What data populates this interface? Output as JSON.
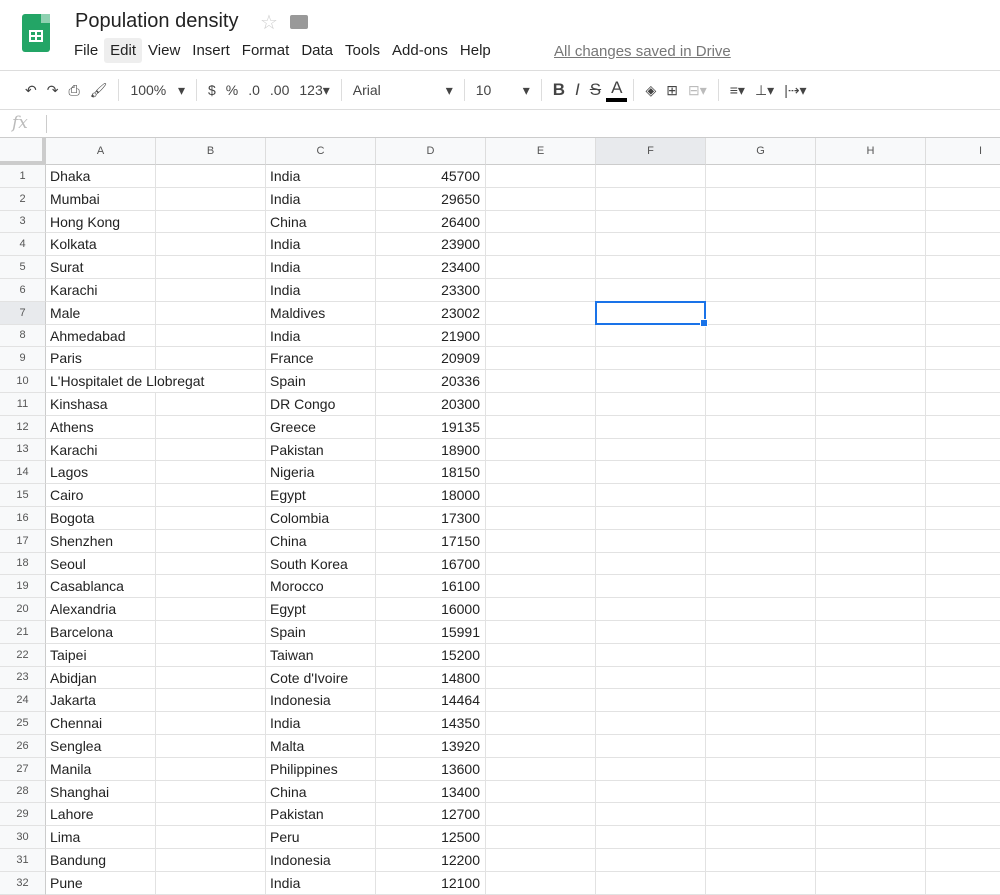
{
  "app": {
    "title": "Population density",
    "status": "All changes saved in Drive"
  },
  "menu": [
    "File",
    "Edit",
    "View",
    "Insert",
    "Format",
    "Data",
    "Tools",
    "Add-ons",
    "Help"
  ],
  "toolbar": {
    "zoom": "100%",
    "currency": "$",
    "percent": "%",
    "dec_decrease": ".0",
    "dec_increase": ".00",
    "more_formats": "123",
    "font": "Arial",
    "font_size": "10",
    "bold": "B",
    "italic": "I",
    "strike": "S",
    "text_color": "A"
  },
  "formula_bar": {
    "fx": "fx",
    "value": ""
  },
  "columns": [
    "A",
    "B",
    "C",
    "D",
    "E",
    "F",
    "G",
    "H",
    "I"
  ],
  "selected_cell": "F7",
  "rows": [
    [
      "Dhaka",
      "India",
      "45700"
    ],
    [
      "Mumbai",
      "India",
      "29650"
    ],
    [
      "Hong Kong",
      "China",
      "26400"
    ],
    [
      "Kolkata",
      "India",
      "23900"
    ],
    [
      "Surat",
      "India",
      "23400"
    ],
    [
      "Karachi",
      "India",
      "23300"
    ],
    [
      "Male",
      "Maldives",
      "23002"
    ],
    [
      "Ahmedabad",
      "India",
      "21900"
    ],
    [
      "Paris",
      "France",
      "20909"
    ],
    [
      "L'Hospitalet de Llobregat",
      "Spain",
      "20336"
    ],
    [
      "Kinshasa",
      "DR Congo",
      "20300"
    ],
    [
      "Athens",
      "Greece",
      "19135"
    ],
    [
      "Karachi",
      "Pakistan",
      "18900"
    ],
    [
      "Lagos",
      "Nigeria",
      "18150"
    ],
    [
      "Cairo",
      "Egypt",
      "18000"
    ],
    [
      "Bogota",
      "Colombia",
      "17300"
    ],
    [
      "Shenzhen",
      "China",
      "17150"
    ],
    [
      "Seoul",
      "South Korea",
      "16700"
    ],
    [
      "Casablanca",
      "Morocco",
      "16100"
    ],
    [
      "Alexandria",
      "Egypt",
      "16000"
    ],
    [
      "Barcelona",
      "Spain",
      "15991"
    ],
    [
      "Taipei",
      "Taiwan",
      "15200"
    ],
    [
      "Abidjan",
      "Cote d'Ivoire",
      "14800"
    ],
    [
      "Jakarta",
      "Indonesia",
      "14464"
    ],
    [
      "Chennai",
      "India",
      "14350"
    ],
    [
      "Senglea",
      "Malta",
      "13920"
    ],
    [
      "Manila",
      "Philippines",
      "13600"
    ],
    [
      "Shanghai",
      "China",
      "13400"
    ],
    [
      "Lahore",
      "Pakistan",
      "12700"
    ],
    [
      "Lima",
      "Peru",
      "12500"
    ],
    [
      "Bandung",
      "Indonesia",
      "12200"
    ],
    [
      "Pune",
      "India",
      "12100"
    ]
  ]
}
